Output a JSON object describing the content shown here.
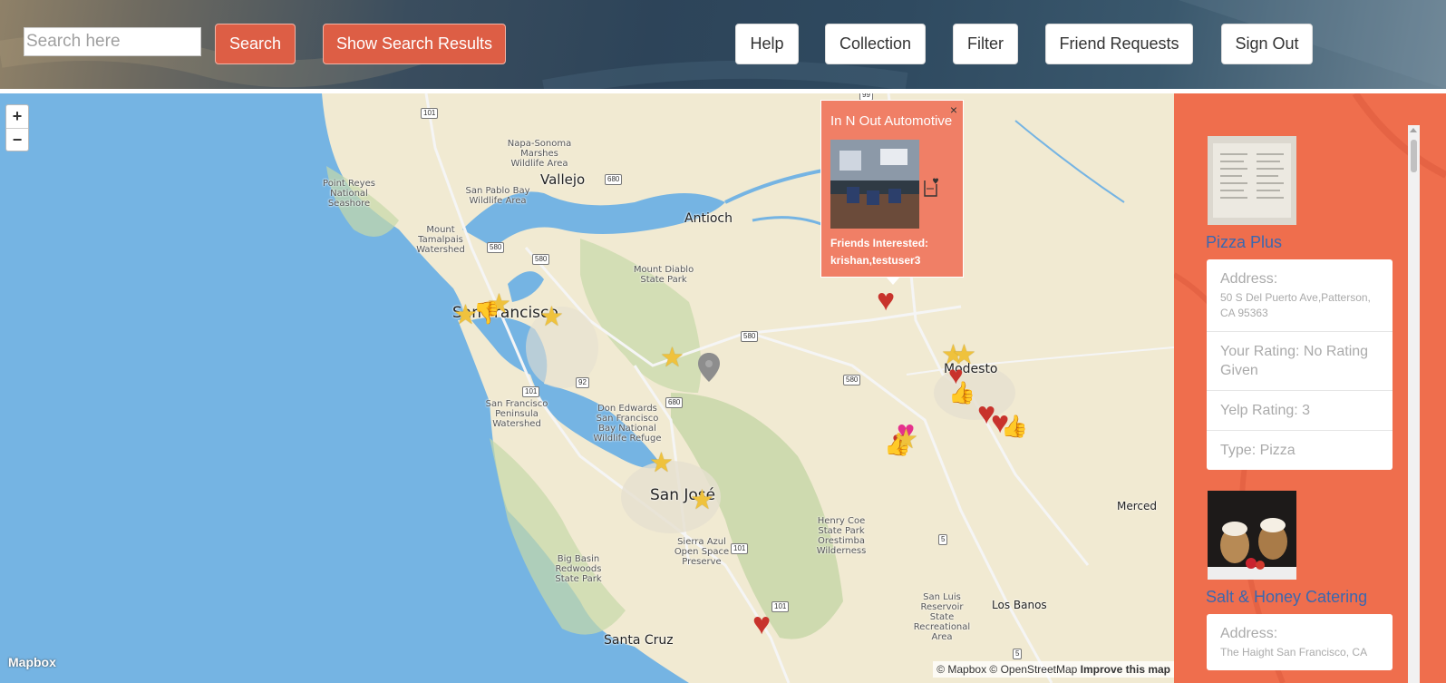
{
  "topbar": {
    "search_placeholder": "Search here",
    "search_label": "Search",
    "show_results_label": "Show Search Results",
    "help_label": "Help",
    "collection_label": "Collection",
    "filter_label": "Filter",
    "friend_requests_label": "Friend Requests",
    "sign_out_label": "Sign Out"
  },
  "map": {
    "zoom_in": "+",
    "zoom_out": "−",
    "logo": "Mapbox",
    "attribution": "© Mapbox © OpenStreetMap",
    "improve": "Improve this map",
    "places": {
      "vallejo": "Vallejo",
      "antioch": "Antioch",
      "san_francisco": "San Francisco",
      "modesto": "Modesto",
      "san_jose": "San José",
      "santa_cruz": "Santa Cruz",
      "los_banos": "Los Banos",
      "merced": "Merced",
      "point_reyes": "Point Reyes National Seashore",
      "napa_sonoma": "Napa-Sonoma Marshes Wildlife Area",
      "san_pablo": "San Pablo Bay Wildlife Area",
      "mount_tamalpais": "Mount Tamalpais Watershed",
      "mount_diablo": "Mount Diablo State Park",
      "sf_peninsula": "San Francisco Peninsula Watershed",
      "don_edwards": "Don Edwards San Francisco Bay National Wildlife Refuge",
      "henry_coe": "Henry Coe State Park Orestimba Wilderness",
      "sierra_azul": "Sierra Azul Open Space Preserve",
      "big_basin": "Big Basin Redwoods State Park",
      "san_luis": "San Luis Reservoir State Recreational Area"
    },
    "highways": {
      "h101a": "101",
      "h580a": "580",
      "h580b": "580",
      "h680a": "680",
      "h680b": "680",
      "h92": "92",
      "h101b": "101",
      "h580c": "580",
      "h580d": "580",
      "h5a": "5",
      "h101c": "101",
      "h101d": "101",
      "h5b": "5",
      "h99": "99"
    },
    "popup": {
      "title": "In N Out Automotive",
      "close": "×",
      "friends_label": "Friends Interested:",
      "friends": "krishan,testuser3"
    }
  },
  "sidebar": {
    "items": [
      {
        "name": "Pizza Plus",
        "address_label": "Address:",
        "address": "50 S Del Puerto Ave,Patterson, CA 95363",
        "your_rating": "Your Rating: No Rating Given",
        "yelp_rating": "Yelp Rating: 3",
        "type": "Type: Pizza"
      },
      {
        "name": "Salt & Honey Catering",
        "address_label": "Address:",
        "address": "The Haight San Francisco, CA"
      }
    ]
  },
  "colors": {
    "accent": "#dd5e45",
    "sidebar_bg": "#ef6e4d",
    "popup_bg": "#f07f66",
    "link": "#3a68b0",
    "water": "#75b4e3"
  }
}
